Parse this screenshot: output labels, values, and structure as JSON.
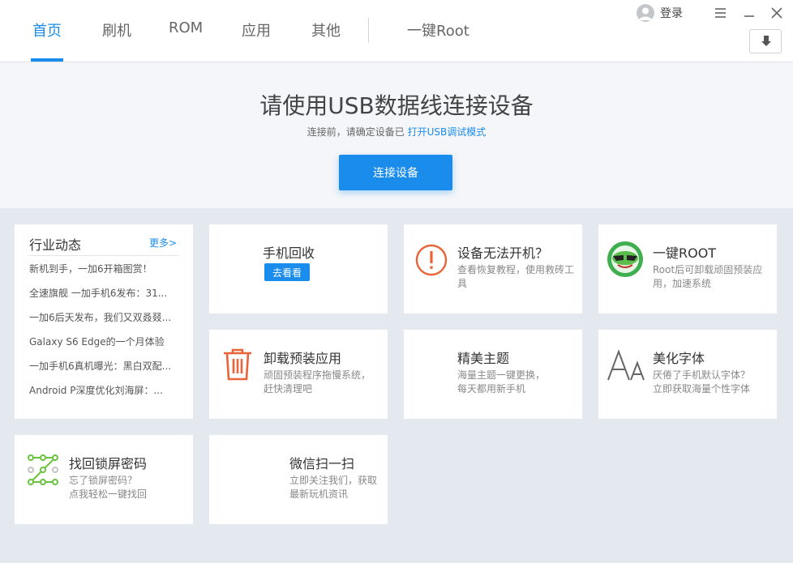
{
  "nav": {
    "tabs": [
      {
        "label": "首页",
        "active": true
      },
      {
        "label": "刷机"
      },
      {
        "label": "ROM"
      },
      {
        "label": "应用"
      },
      {
        "label": "其他"
      }
    ],
    "root_tab": "一键Root"
  },
  "user": {
    "login_label": "登录"
  },
  "window_controls": {
    "menu": "menu-icon",
    "minimize": "minimize-icon",
    "close": "close-icon",
    "download": "download-icon"
  },
  "hero": {
    "title": "请使用USB数据线连接设备",
    "subtitle_prefix": "连接前，请确定设备已",
    "subtitle_link": "打开USB调试模式",
    "connect_button": "连接设备"
  },
  "news": {
    "title": "行业动态",
    "more": "更多>",
    "items": [
      "新机到手，一加6开箱图赏！",
      "全速旗舰 一加手机6发布：31...",
      "一加6后天发布，我们又双叒叕...",
      "Galaxy S6 Edge的一个月体验",
      "一加手机6真机曝光：黑白双配...",
      "Android P深度优化刘海屏：..."
    ]
  },
  "cards": {
    "recycle": {
      "title": "手机回收",
      "button": "去看看"
    },
    "no_boot": {
      "title": "设备无法开机？",
      "desc": "查看恢复教程，使用救砖工具"
    },
    "root": {
      "title": "一键ROOT",
      "desc": "Root后可卸载顽固预装应用，加速系统"
    },
    "uninstall": {
      "title": "卸载预装应用",
      "desc1": "顽固预装程序拖慢系统，",
      "desc2": "赶快清理吧"
    },
    "theme": {
      "title": "精美主题",
      "desc1": "海量主题一键更换，",
      "desc2": "每天都用新手机"
    },
    "font": {
      "title": "美化字体",
      "desc1": "厌倦了手机默认字体？",
      "desc2": "立即获取海量个性字体"
    },
    "lock": {
      "title": "找回锁屏密码",
      "desc1": "忘了锁屏密码？",
      "desc2": "点我轻松一键找回"
    },
    "wechat": {
      "title": "微信扫一扫",
      "desc1": "立即关注我们，获取",
      "desc2": "最新玩机资讯"
    }
  },
  "colors": {
    "accent": "#1a8ceb",
    "warning": "#e9643a",
    "lock_green": "#6ac23e",
    "root_green": "#3fae4f"
  }
}
